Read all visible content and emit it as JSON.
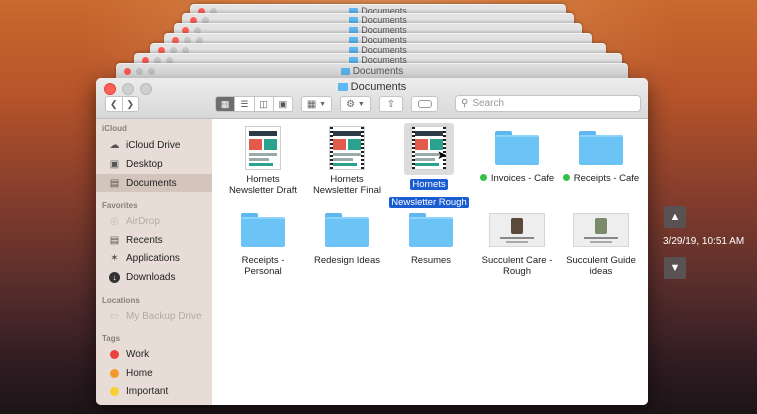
{
  "background_windows": [
    {
      "title": "Documents"
    },
    {
      "title": "Documents"
    },
    {
      "title": "Documents"
    },
    {
      "title": "Documents"
    },
    {
      "title": "Documents"
    },
    {
      "title": "Documents"
    },
    {
      "title": "Documents"
    }
  ],
  "window": {
    "title": "Documents",
    "search_placeholder": "Search"
  },
  "sidebar": {
    "icloud_header": "iCloud",
    "icloud_items": [
      {
        "label": "iCloud Drive",
        "icon": "cloud-icon"
      },
      {
        "label": "Desktop",
        "icon": "desktop-icon"
      },
      {
        "label": "Documents",
        "icon": "documents-icon",
        "selected": true
      }
    ],
    "favorites_header": "Favorites",
    "favorites_items": [
      {
        "label": "AirDrop",
        "icon": "airdrop-icon",
        "dimmed": true
      },
      {
        "label": "Recents",
        "icon": "clock-icon"
      },
      {
        "label": "Applications",
        "icon": "applications-icon"
      },
      {
        "label": "Downloads",
        "icon": "downloads-icon"
      }
    ],
    "locations_header": "Locations",
    "locations_items": [
      {
        "label": "My Backup Drive",
        "icon": "drive-icon",
        "dimmed": true
      }
    ],
    "tags_header": "Tags",
    "tags": [
      {
        "label": "Work",
        "color": "#e8433d"
      },
      {
        "label": "Home",
        "color": "#f39a2b"
      },
      {
        "label": "Important",
        "color": "#f6d02e"
      }
    ]
  },
  "files": [
    {
      "name": "Hornets Newsletter Draft",
      "line1": "Hornets",
      "line2": "Newsletter Draft",
      "kind": "doc"
    },
    {
      "name": "Hornets Newsletter Final",
      "line1": "Hornets",
      "line2": "Newsletter Final",
      "kind": "doc-film"
    },
    {
      "name": "Hornets Newsletter Rough",
      "line1": "Hornets",
      "line2": "Newsletter Rough",
      "kind": "doc-film",
      "selected": true
    },
    {
      "name": "Invoices - Cafe",
      "line1": "Invoices - Cafe",
      "kind": "folder",
      "tag_color": "#35c04a"
    },
    {
      "name": "Receipts - Cafe",
      "line1": "Receipts - Cafe",
      "kind": "folder",
      "tag_color": "#35c04a"
    },
    {
      "name": "Receipts - Personal",
      "line1": "Receipts -",
      "line2": "Personal",
      "kind": "folder"
    },
    {
      "name": "Redesign Ideas",
      "line1": "Redesign Ideas",
      "kind": "folder"
    },
    {
      "name": "Resumes",
      "line1": "Resumes",
      "kind": "folder"
    },
    {
      "name": "Succulent Care - Rough",
      "line1": "Succulent Care -",
      "line2": "Rough",
      "kind": "wide"
    },
    {
      "name": "Succulent Guide ideas",
      "line1": "Succulent Guide",
      "line2": "ideas",
      "kind": "wide"
    }
  ],
  "timemachine": {
    "timestamp": "3/29/19, 10:51 AM",
    "up_icon": "chevron-up-icon",
    "down_icon": "chevron-down-icon"
  }
}
